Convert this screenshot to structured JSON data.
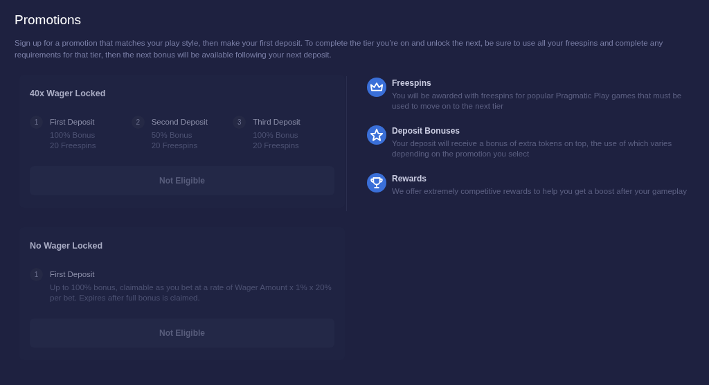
{
  "title": "Promotions",
  "intro": "Sign up for a promotion that matches your play style, then make your first deposit. To complete the tier you’re on and unlock the next, be sure to use all your freespins and complete any requirements for that tier, then the next bonus will be available following your next deposit.",
  "promotions": [
    {
      "name": "40x Wager Locked",
      "steps": [
        {
          "number": "1",
          "title": "First Deposit",
          "lines": [
            "100% Bonus",
            "20 Freespins"
          ]
        },
        {
          "number": "2",
          "title": "Second Deposit",
          "lines": [
            "50% Bonus",
            "20 Freespins"
          ]
        },
        {
          "number": "3",
          "title": "Third Deposit",
          "lines": [
            "100% Bonus",
            "20 Freespins"
          ]
        }
      ],
      "button": {
        "label": "Not Eligible",
        "disabled": true
      }
    },
    {
      "name": "No Wager Locked",
      "steps": [
        {
          "number": "1",
          "title": "First Deposit",
          "lines": [
            "Up to 100% bonus, claimable as you bet at a rate of Wager Amount x 1% x 20% per bet. Expires after full bonus is claimed."
          ]
        }
      ],
      "button": {
        "label": "Not Eligible",
        "disabled": true
      }
    }
  ],
  "features": [
    {
      "title": "Freespins",
      "text": "You will be awarded with freespins for popular Pragmatic Play games that must be used to move on to the next tier"
    },
    {
      "title": "Deposit Bonuses",
      "text": "Your deposit will receive a bonus of extra tokens on top, the use of which varies depending on the promotion you select"
    },
    {
      "title": "Rewards",
      "text": "We offer extremely competitive rewards to help you get a boost after your gameplay"
    }
  ]
}
